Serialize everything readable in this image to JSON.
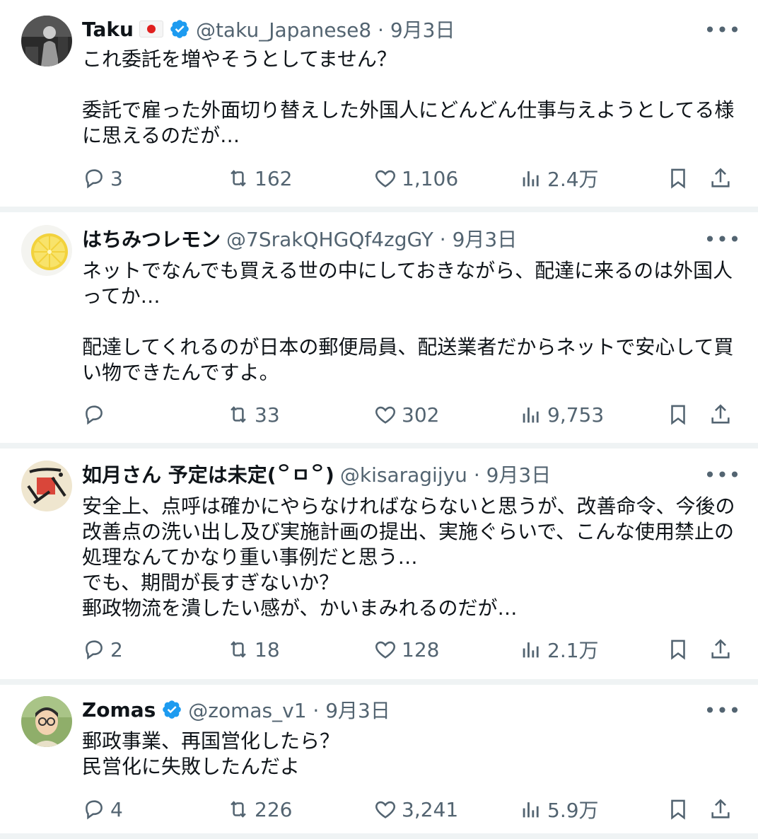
{
  "colors": {
    "text": "#0f1419",
    "secondary": "#536471",
    "verified": "#1d9bf0",
    "divider": "#eff3f4"
  },
  "tweets": [
    {
      "name": "Taku",
      "flag": "🇯🇵",
      "handle": "@taku_Japanese8 · 9月3日",
      "text": "これ委託を増やそうとしてません？\n\n委託で雇った外面切り替えした外国人にどんどん仕事与えようとしてる様に思えるのだが…",
      "replies": "3",
      "retweets": "162",
      "likes": "1,106",
      "views": "2.4万"
    },
    {
      "name": "はちみつレモン",
      "handle": "@7SrakQHGQf4zgGY · 9月3日",
      "text": "ネットでなんでも買える世の中にしておきながら、配達に来るのは外国人ってか…\n\n配達してくれるのが日本の郵便局員、配送業者だからネットで安心して買い物できたんですよ。",
      "replies": "",
      "retweets": "33",
      "likes": "302",
      "views": "9,753"
    },
    {
      "name": "如月さん 予定は未定(꒪ㅁ꒪)",
      "handle": "@kisaragijyu · 9月3日",
      "text": "安全上、点呼は確かにやらなければならないと思うが、改善命令、今後の改善点の洗い出し及び実施計画の提出、実施ぐらいで、こんな使用禁止の処理なんてかなり重い事例だと思う…\nでも、期間が長すぎないか？\n郵政物流を潰したい感が、かいまみれるのだが…",
      "replies": "2",
      "retweets": "18",
      "likes": "128",
      "views": "2.1万"
    },
    {
      "name": "Zomas",
      "handle": "@zomas_v1 · 9月3日",
      "text": "郵政事業、再国営化したら？\n民営化に失敗したんだよ",
      "replies": "4",
      "retweets": "226",
      "likes": "3,241",
      "views": "5.9万"
    }
  ],
  "icons": {
    "reply": "reply-icon",
    "retweet": "retweet-icon",
    "like": "like-icon",
    "views": "views-icon",
    "bookmark": "bookmark-icon",
    "share": "share-icon",
    "more": "more-icon",
    "verified": "verified-badge-icon"
  },
  "more_label": "•••"
}
